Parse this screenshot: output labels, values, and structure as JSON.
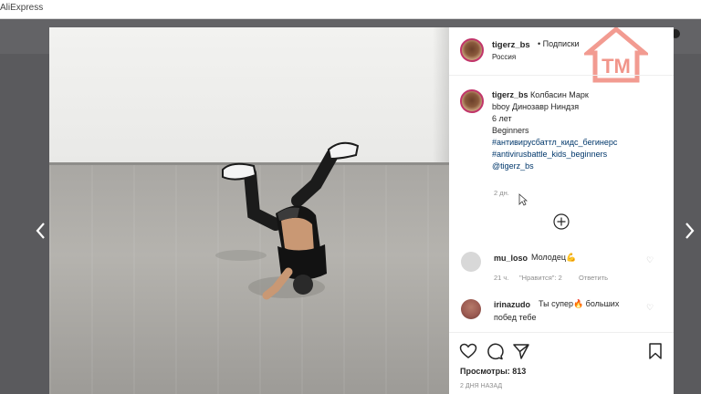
{
  "browser": {
    "title": "AliExpress"
  },
  "post": {
    "author": "tigerz_bs",
    "follow_label": "• Подписки",
    "location": "Россия",
    "caption_user": "tigerz_bs",
    "caption_lines": [
      "Колбасин Марк",
      "bboy Динозавр Ниндзя",
      "6 лет",
      "Beginners",
      "#антивирусбаттл_кидс_бегинерс",
      "#antivirusbattle_kids_beginners",
      "@tigerz_bs"
    ],
    "caption_age": "2 дн.",
    "comments": [
      {
        "user": "mu_loso",
        "text": "Молодец💪",
        "age": "21 ч.",
        "likes": "\"Нравится\": 2",
        "reply": "Ответить"
      },
      {
        "user": "irinazudo",
        "text": "Ты супер🔥 больших",
        "text2": "побед тебе"
      }
    ],
    "views": "Просмотры: 813",
    "posted": "2 ДНЯ НАЗАД"
  },
  "colors": {
    "story_ring": "#c1356a",
    "watermark": "#f08a7e"
  },
  "icons": {
    "like": "heart-icon",
    "comment": "comment-icon",
    "share": "share-icon",
    "save": "bookmark-icon",
    "load_more": "plus-circle-icon"
  }
}
